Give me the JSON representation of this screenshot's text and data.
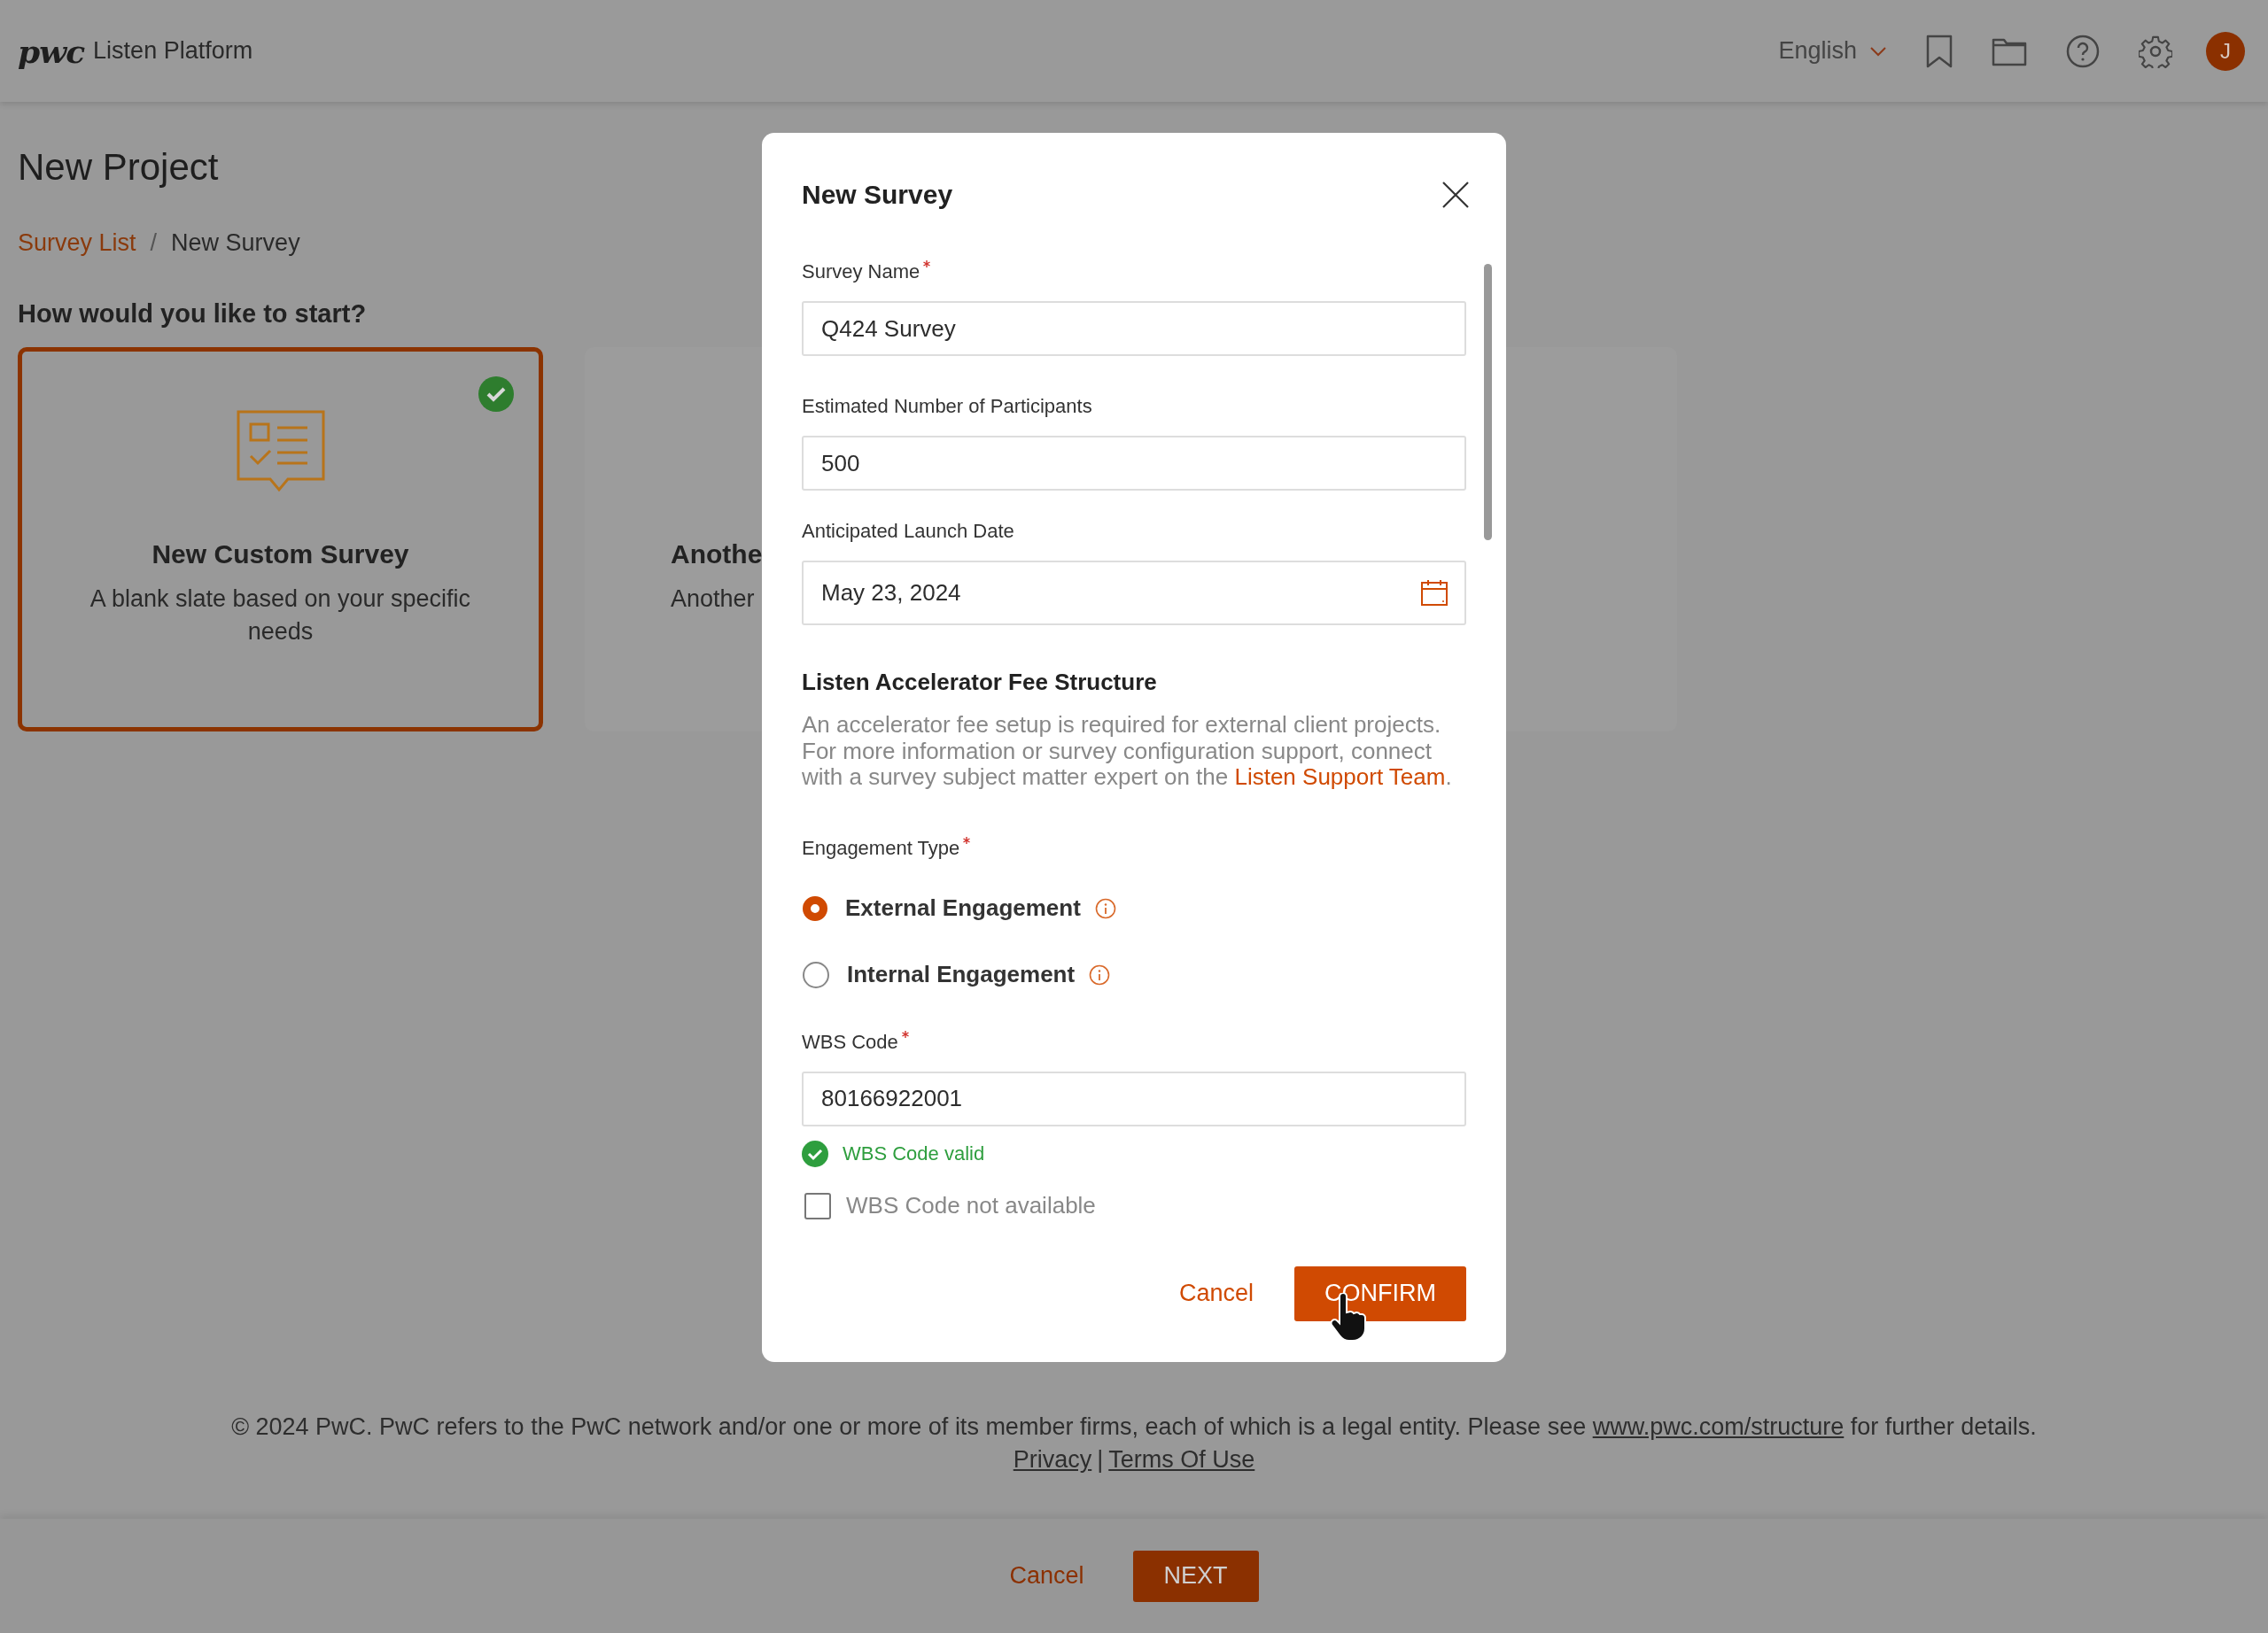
{
  "header": {
    "logo": "pwc",
    "app_name": "Listen Platform",
    "language": "English",
    "avatar": "J"
  },
  "page": {
    "title": "New Project",
    "breadcrumb": [
      {
        "label": "Survey List",
        "link": true
      },
      {
        "label": "New Survey",
        "link": false
      }
    ],
    "breadcrumb_separator": "/",
    "prompt": "How would you like to start?",
    "cards": [
      {
        "title": "New Custom Survey",
        "description": "A blank slate based on your specific needs",
        "selected": true
      },
      {
        "title": "Anothe",
        "description": "Another",
        "selected": false
      }
    ]
  },
  "modal": {
    "title": "New Survey",
    "fields": [
      {
        "kind": "text",
        "label": "Survey Name",
        "required": true,
        "value": "Q424 Survey"
      },
      {
        "kind": "text",
        "label": "Estimated Number of Participants",
        "required": false,
        "value": "500"
      },
      {
        "kind": "date",
        "label": "Anticipated Launch Date",
        "required": false,
        "value": "May 23, 2024"
      }
    ],
    "fee_heading": "Listen Accelerator Fee Structure",
    "fee_text": {
      "text": "An accelerator fee setup is required for external client projects. For more information or survey configuration support, connect with a survey subject matter expert on the ",
      "link": "Listen Support Team",
      "after": "."
    },
    "engagement": {
      "label": "Engagement Type",
      "required": true,
      "options": [
        {
          "label": "External Engagement",
          "selected": true
        },
        {
          "label": "Internal Engagement",
          "selected": false
        }
      ]
    },
    "wbs": {
      "label": "WBS Code",
      "required": true,
      "value": "80166922001",
      "validation": {
        "valid": true,
        "message": "WBS Code valid"
      }
    },
    "wbs_unavailable": {
      "label": "WBS Code not available",
      "checked": false
    },
    "buttons": [
      {
        "kind": "secondary",
        "label": "Cancel"
      },
      {
        "kind": "primary",
        "label": "CONFIRM"
      }
    ]
  },
  "footer": {
    "notice": {
      "text": "© 2024 PwC. PwC refers to the PwC network and/or one or more of its member firms, each of which is a legal entity. Please see ",
      "link": "www.pwc.com/structure",
      "after": " for further details."
    },
    "links": [
      "Privacy",
      "Terms Of Use"
    ],
    "link_separator": "|"
  },
  "bottom_bar": {
    "buttons": [
      {
        "kind": "secondary",
        "label": "Cancel"
      },
      {
        "kind": "primary",
        "label": "NEXT"
      }
    ]
  }
}
